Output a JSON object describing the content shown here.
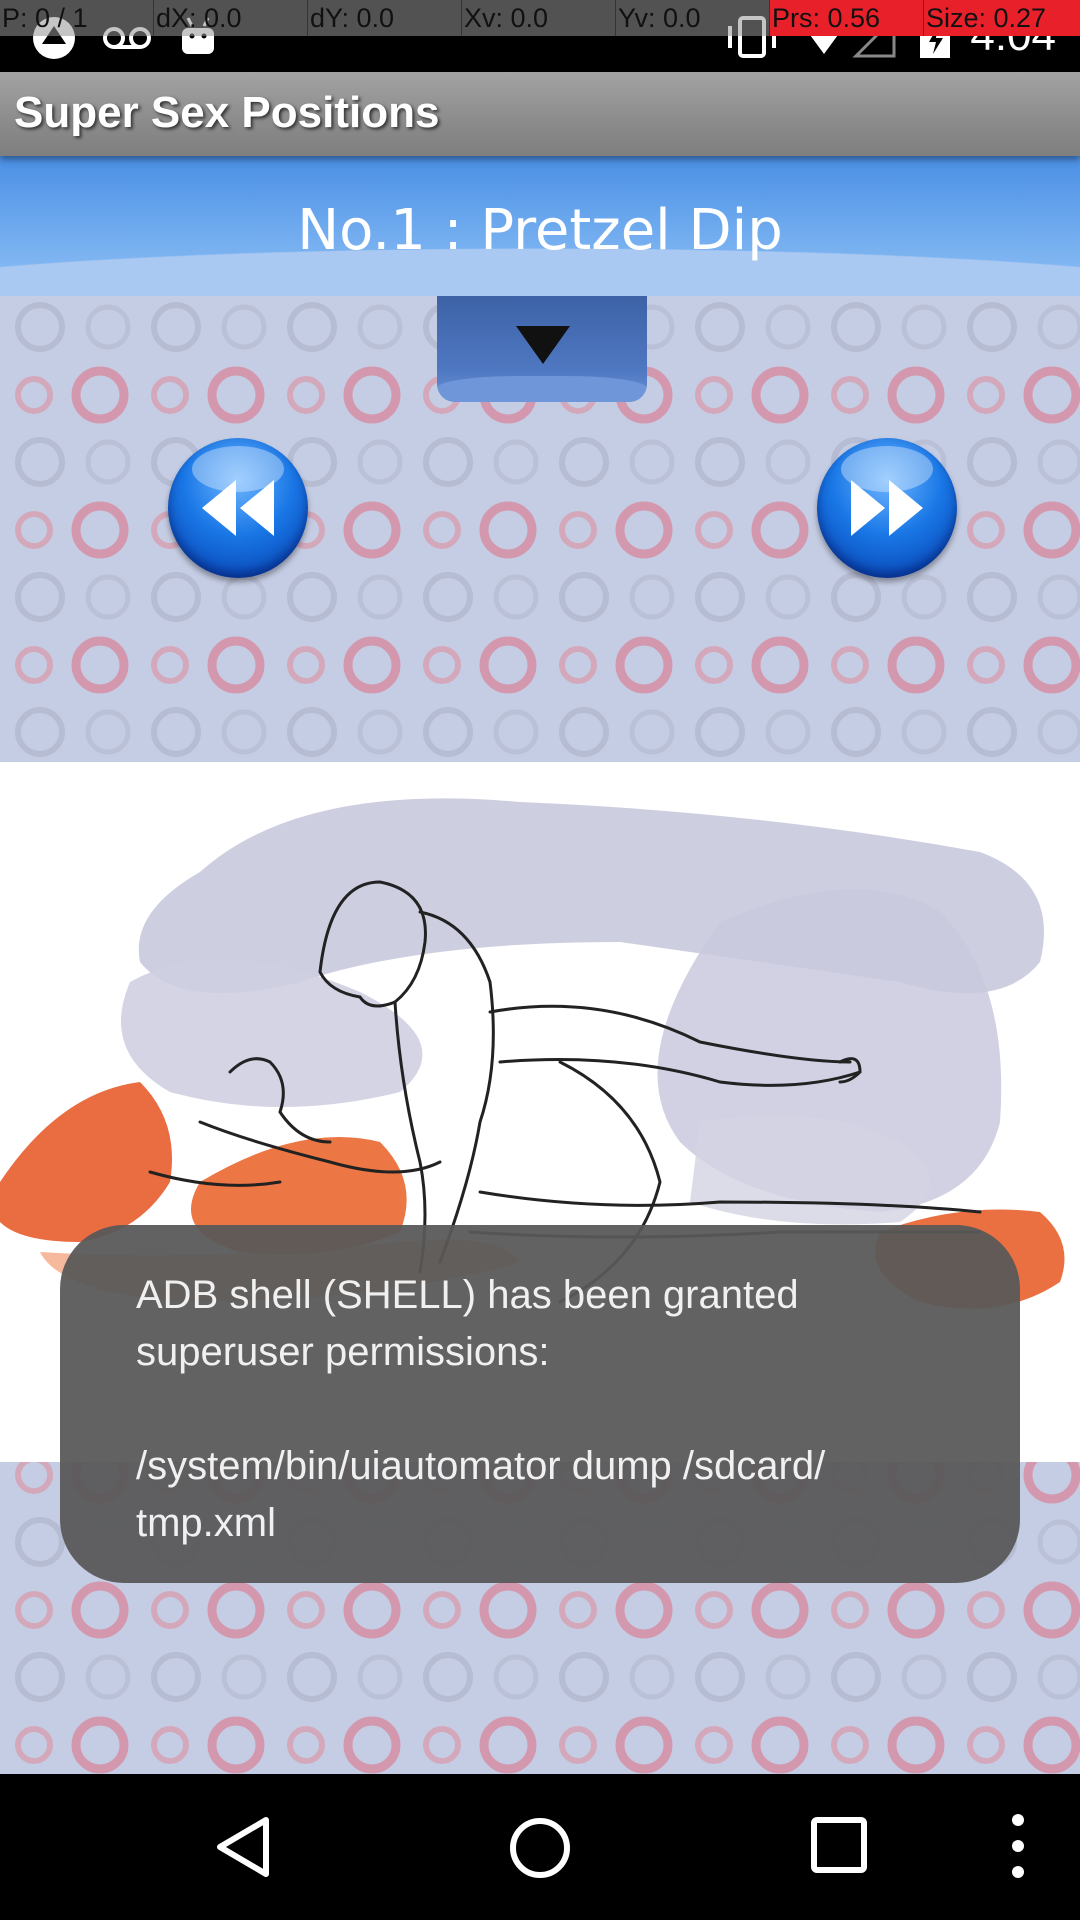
{
  "debug_bar": {
    "pointer": "P: 0 / 1",
    "dx": "dX: 0.0",
    "dy": "dY: 0.0",
    "xv": "Xv: 0.0",
    "yv": "Yv: 0.0",
    "prs": "Prs: 0.56",
    "size": "Size: 0.27"
  },
  "status_bar": {
    "time": "4:04",
    "icons": [
      "app-notification-icon",
      "voicemail-icon",
      "android-debug-icon",
      "vibrate-icon",
      "wifi-icon",
      "signal-icon",
      "battery-icon"
    ]
  },
  "app": {
    "title": "Super Sex Positions"
  },
  "position": {
    "title": "No.1 : Pretzel Dip"
  },
  "controls": {
    "dropdown_icon": "triangle-down-icon",
    "prev_icon": "rewind-icon",
    "next_icon": "fast-forward-icon"
  },
  "toast": {
    "line1": "ADB shell (SHELL) has been granted",
    "line2": "superuser permissions:",
    "line3": "/system/bin/uiautomator dump /sdcard/",
    "line4": "tmp.xml"
  },
  "nav_bar": {
    "icons": [
      "back-icon",
      "home-icon",
      "recents-icon",
      "overflow-menu-icon"
    ]
  },
  "colors": {
    "header_blue": "#4a8fe4",
    "nav_button_blue": "#1a78e6",
    "debug_alert": "#e8202a",
    "background_pattern": "#c5cde4"
  }
}
